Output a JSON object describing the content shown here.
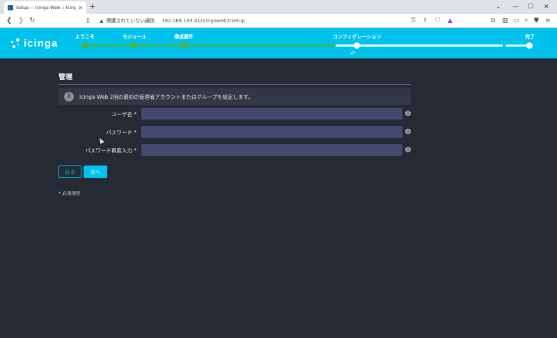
{
  "browser": {
    "tab_title": "Setup :: Icinga Web :: Icinga We",
    "new_tab": "+",
    "security_warning": "保護されていない通信",
    "url": "192.168.193.41/icingaweb2/setup"
  },
  "brand": {
    "logo_text": "icinga"
  },
  "wizard": {
    "steps": [
      {
        "label": "ようこそ",
        "state": "done"
      },
      {
        "label": "モジュール",
        "state": "done"
      },
      {
        "label": "構成要件",
        "state": "done"
      },
      {
        "label": "コンフィグレーション",
        "state": "current"
      },
      {
        "label": "完了",
        "state": "pending"
      }
    ],
    "colors": {
      "done": "#52b03a",
      "current": "#ffffff",
      "pending": "#ffffff",
      "bar_bg": "#00c3ed"
    }
  },
  "form": {
    "title": "管理",
    "info": "Icinga Web 2用の最初の管理者アカウントまたはグループを設定します。",
    "fields": [
      {
        "label": "ユーザ名 *",
        "value": ""
      },
      {
        "label": "パスワード *",
        "value": ""
      },
      {
        "label": "パスワード再度入力 *",
        "value": ""
      }
    ],
    "back_label": "戻る",
    "next_label": "次へ",
    "required_note": "* 必須項目"
  }
}
